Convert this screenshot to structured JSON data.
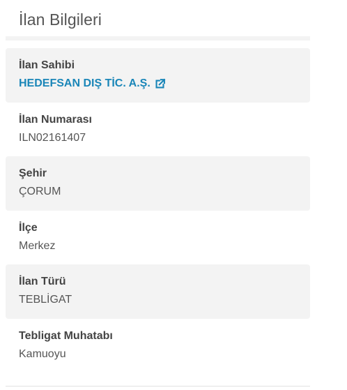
{
  "section": {
    "title": "İlan Bilgileri"
  },
  "details": [
    {
      "label": "İlan Sahibi",
      "value": "HEDEFSAN DIŞ TİC. A.Ş.",
      "icon": "external-link-icon"
    },
    {
      "label": "İlan Numarası",
      "value": "ILN02161407"
    },
    {
      "label": "Şehir",
      "value": "ÇORUM"
    },
    {
      "label": "İlçe",
      "value": "Merkez"
    },
    {
      "label": "İlan Türü",
      "value": "TEBLİGAT"
    },
    {
      "label": "Tebligat Muhatabı",
      "value": "Kamuoyu"
    }
  ],
  "colors": {
    "link": "#1a86b8",
    "row_shade": "#f3f3f3",
    "label": "#444444",
    "value": "#555555"
  }
}
